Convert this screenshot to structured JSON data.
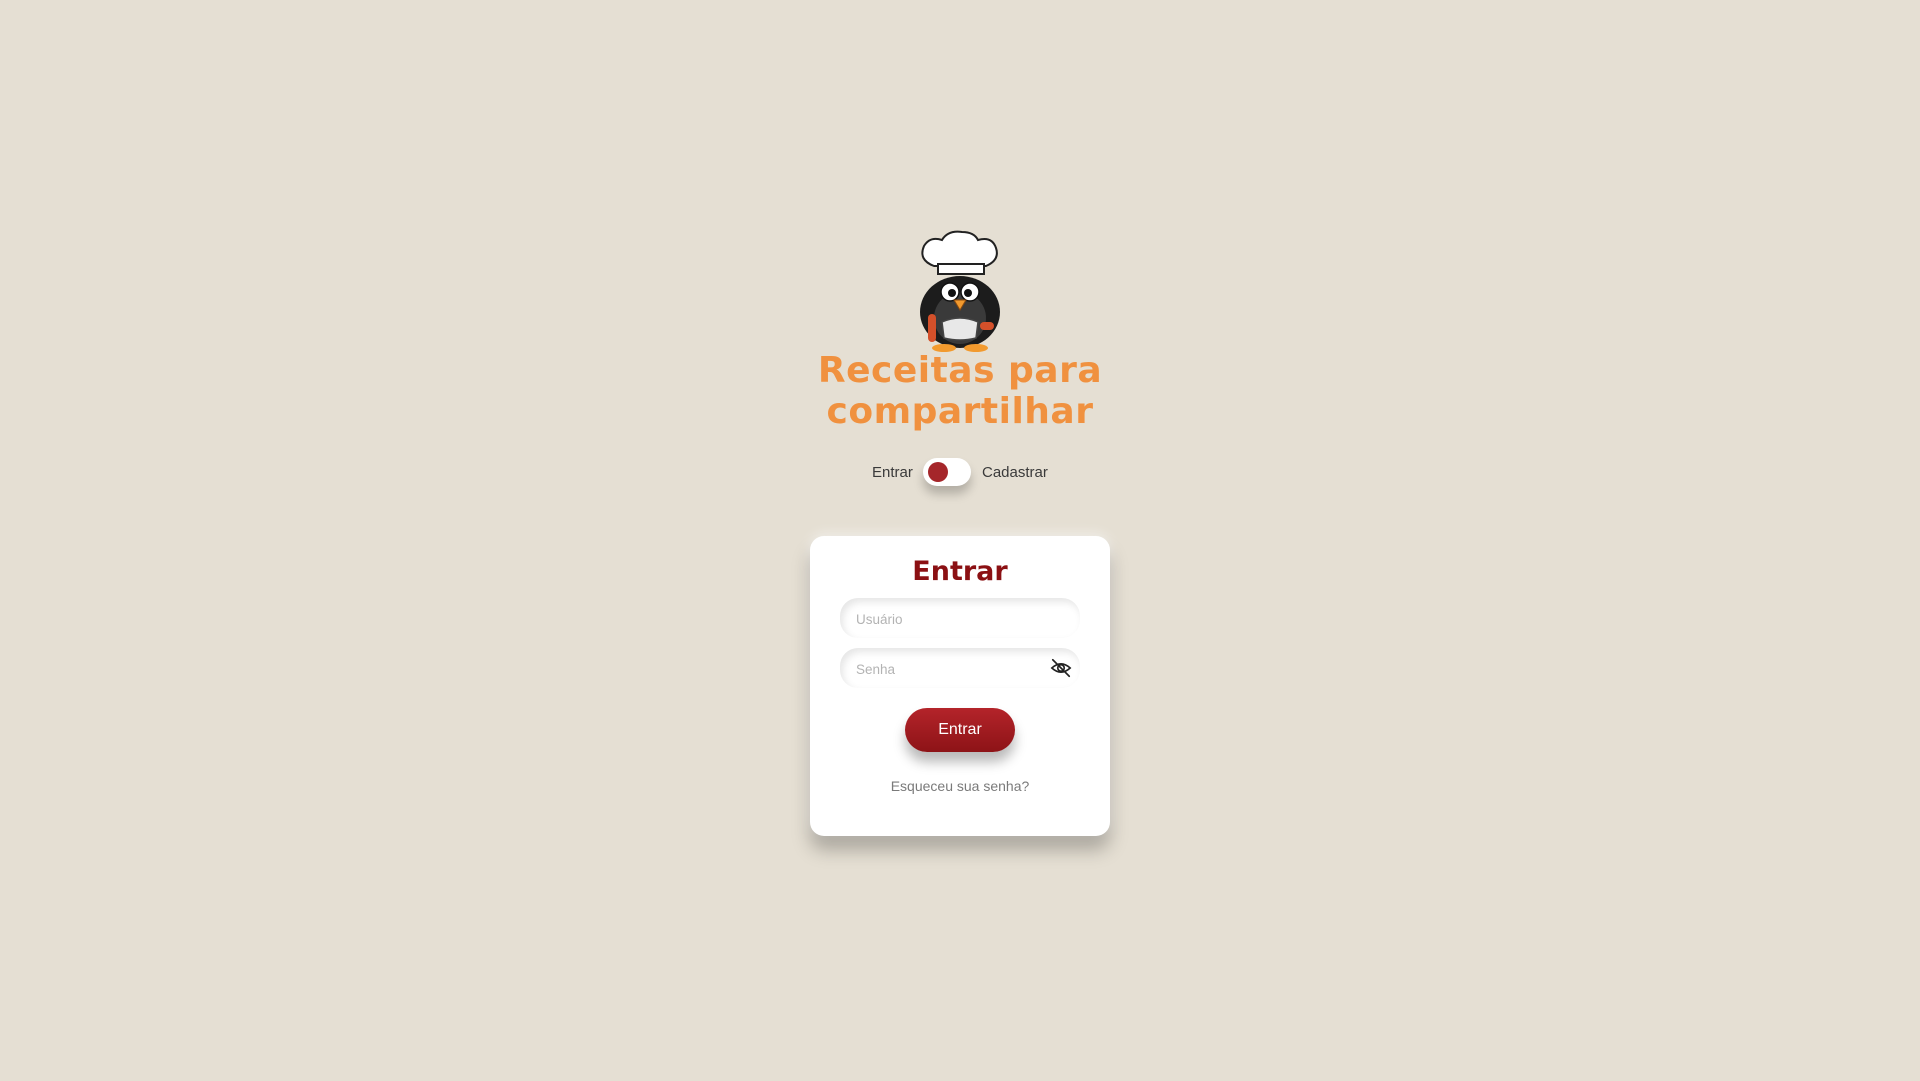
{
  "app": {
    "title": "Receitas para compartilhar",
    "title_color": "#f0913f",
    "logo_icon": "chef-penguin-logo"
  },
  "mode_switch": {
    "left_label": "Entrar",
    "right_label": "Cadastrar",
    "selected": "Entrar",
    "knob_color": "#a5262a"
  },
  "login_card": {
    "title": "Entrar",
    "title_color": "#8b1013",
    "username": {
      "value": "",
      "placeholder": "Usuário"
    },
    "password": {
      "value": "",
      "placeholder": "Senha",
      "toggle_icon": "eye-slash-icon"
    },
    "submit_label": "Entrar",
    "submit_color": "#a01c20",
    "forgot_link": "Esqueceu sua senha?"
  },
  "background_color": "#e5dfd3"
}
